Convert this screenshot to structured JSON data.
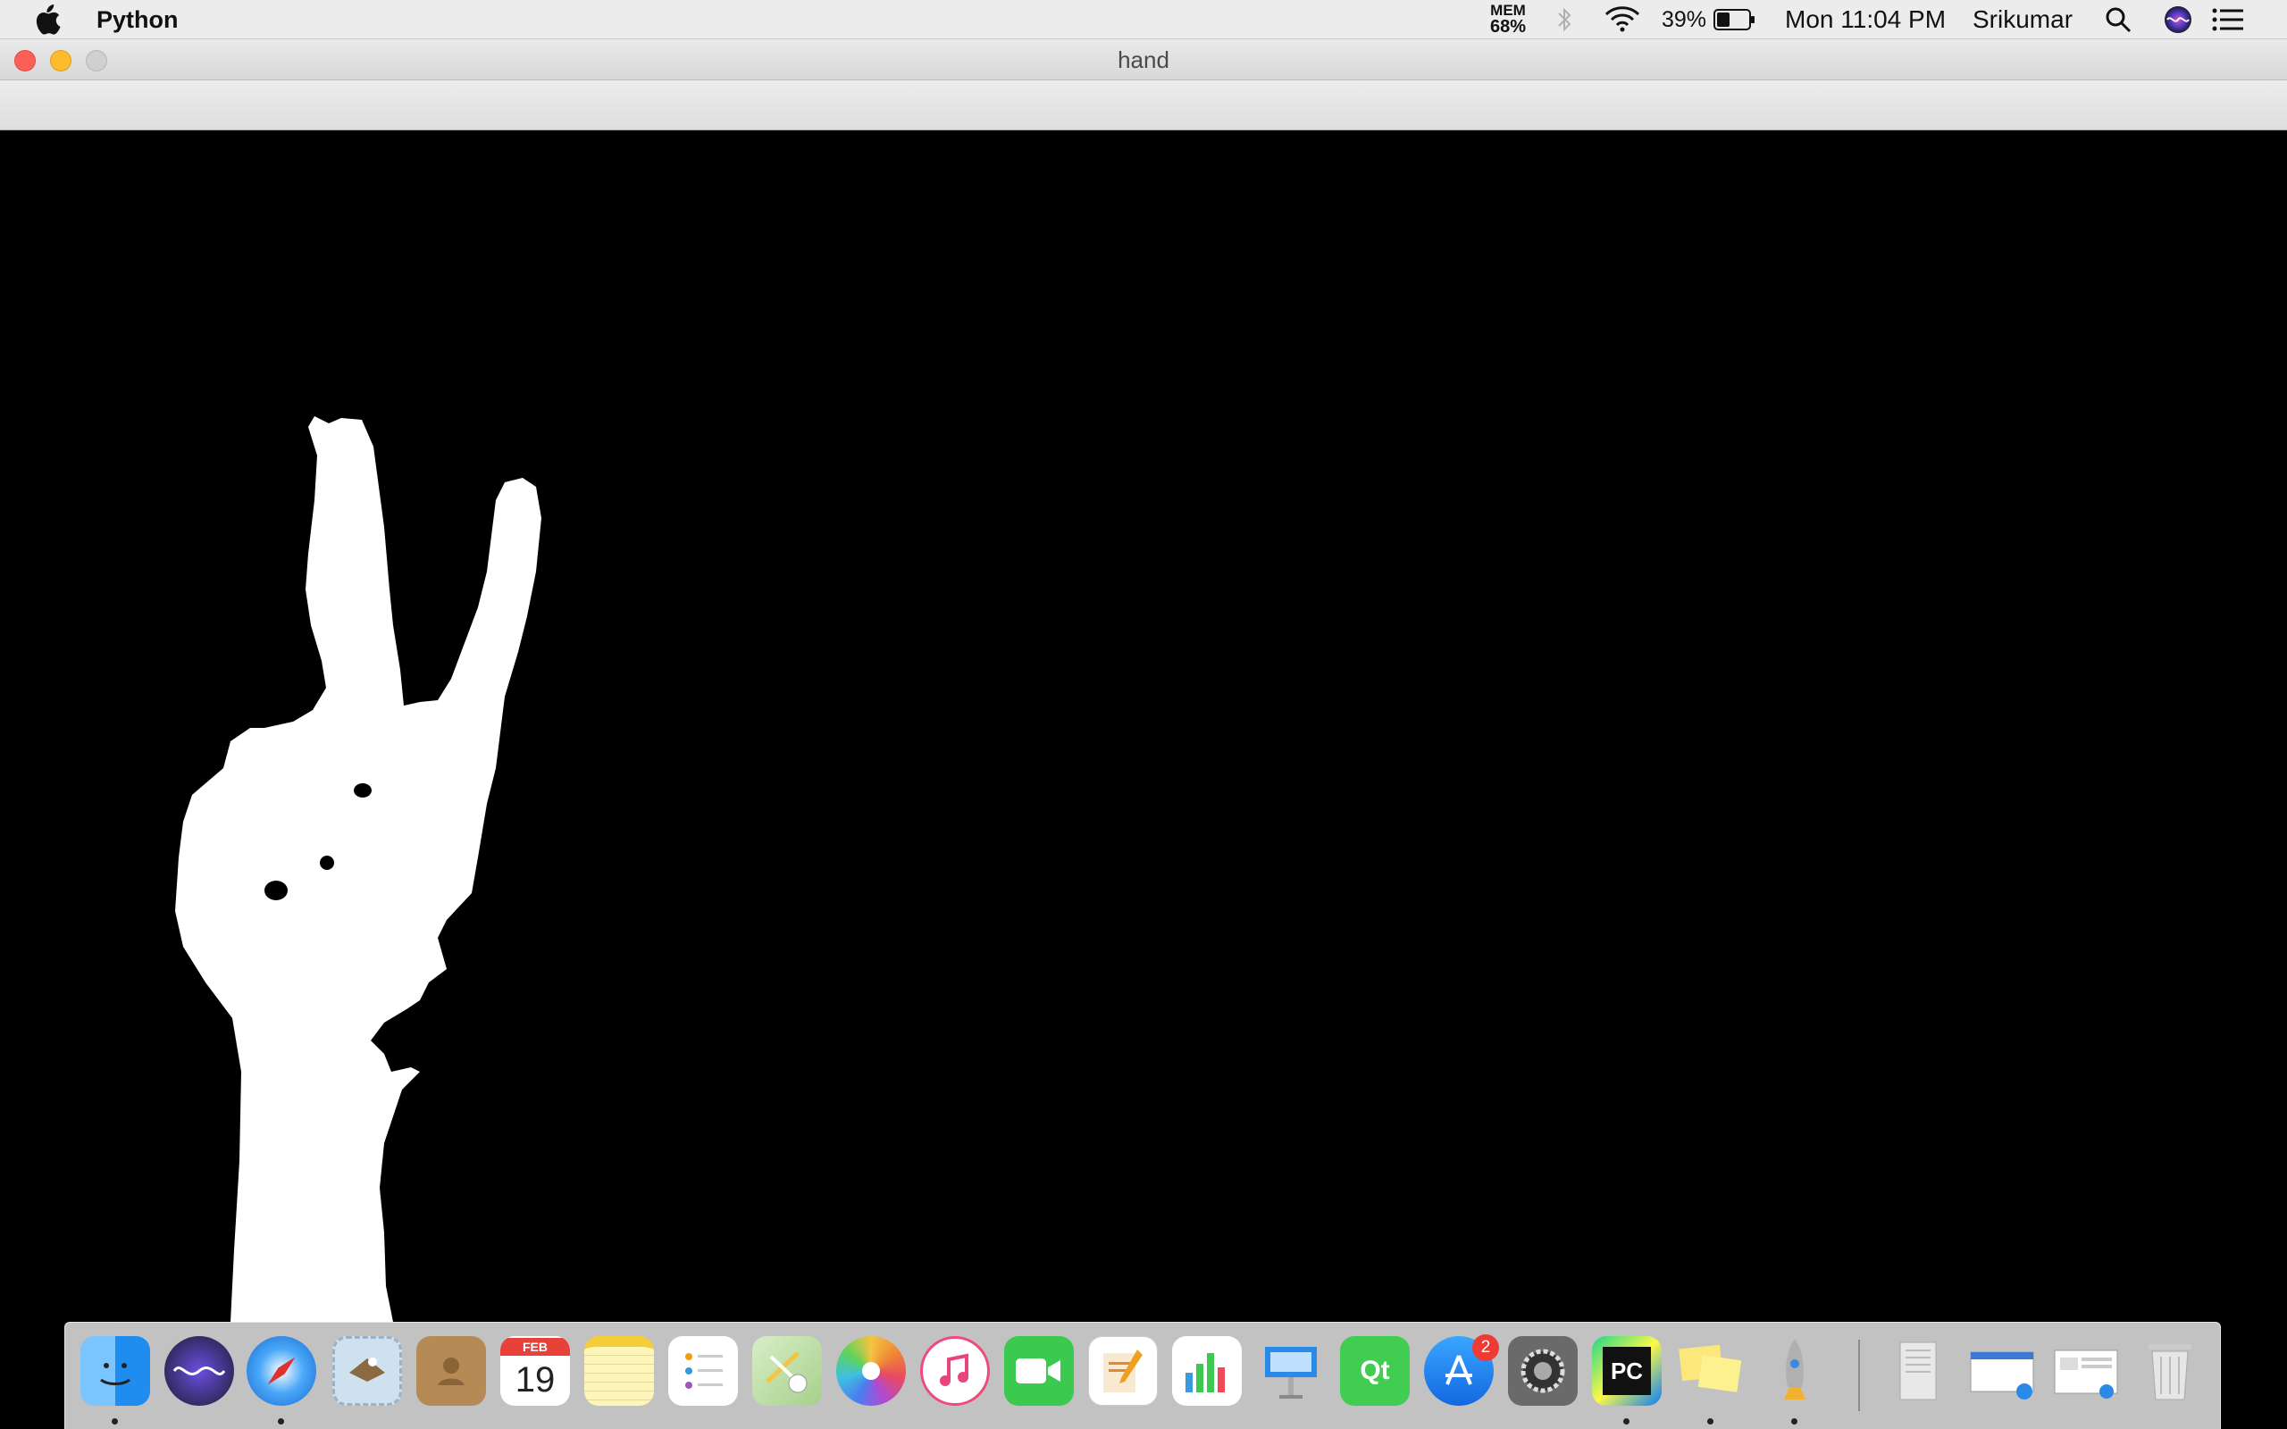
{
  "menubar": {
    "app_name": "Python",
    "mem_label": "MEM",
    "mem_value": "68%",
    "battery_percent": "39%",
    "clock": "Mon 11:04 PM",
    "user": "Srikumar",
    "icons": [
      "apple-icon",
      "bluetooth-icon",
      "wifi-icon",
      "battery-icon",
      "spotlight-search-icon",
      "siri-icon",
      "notification-center-icon"
    ]
  },
  "window": {
    "title": "hand",
    "content": "binary hand mask (white hand on black background)"
  },
  "dock": {
    "calendar_month": "FEB",
    "calendar_day": "19",
    "app_store_badge": "2",
    "pycharm_label": "PC",
    "qt_label": "Qt",
    "apps": [
      "Finder",
      "Siri",
      "Safari",
      "Mail",
      "Contacts",
      "Calendar",
      "Notes",
      "Reminders",
      "Maps",
      "Photos",
      "iTunes",
      "FaceTime",
      "Pages",
      "Numbers",
      "Keynote",
      "Qt Creator",
      "App Store",
      "System Preferences",
      "PyCharm",
      "Stickies",
      "Launchpad",
      "Downloads",
      "Document",
      "Window",
      "Trash"
    ],
    "colors": {
      "finder": "#3aa0f0",
      "siri": "#2a2a40",
      "safari": "#1e7fe0",
      "facetime": "#3bc94f",
      "numbers": "#ffffff",
      "qt": "#41cd52",
      "pycharm": "#1a1a1a",
      "appstore": "#1c8ef7"
    }
  }
}
